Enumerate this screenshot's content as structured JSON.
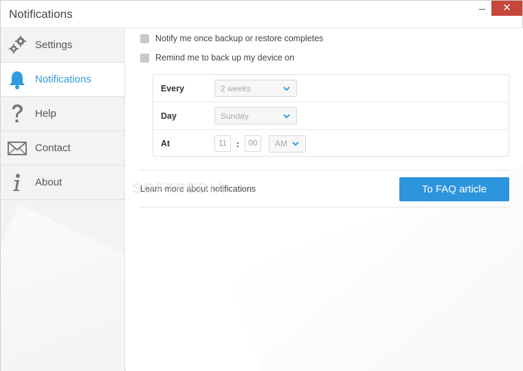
{
  "window": {
    "title": "Notifications",
    "minimize_glyph": "",
    "close_glyph": "✕"
  },
  "sidebar": {
    "items": [
      {
        "label": "Settings",
        "icon": "gears-icon"
      },
      {
        "label": "Notifications",
        "icon": "bell-icon",
        "active": true
      },
      {
        "label": "Help",
        "icon": "question-mark-icon"
      },
      {
        "label": "Contact",
        "icon": "envelope-icon"
      },
      {
        "label": "About",
        "icon": "info-icon"
      }
    ]
  },
  "main": {
    "notify_backup": {
      "label": "Notify me once backup or restore completes",
      "checked": false
    },
    "remind_backup": {
      "label": "Remind me to back up my device on",
      "checked": false
    },
    "schedule": {
      "every_label": "Every",
      "every_value": "2 weeks",
      "day_label": "Day",
      "day_value": "Sunday",
      "at_label": "At",
      "hour_value": "11",
      "time_separator": ":",
      "minute_value": "00",
      "ampm_value": "AM"
    },
    "faq": {
      "text": "Learn more about notifications",
      "button_label": "To FAQ article"
    }
  },
  "watermark": "SOFTPEDIA",
  "colors": {
    "accent": "#2d95dc",
    "active_text": "#2f9be0",
    "close_button": "#c7463a",
    "sidebar_bg": "#f3f3f3"
  }
}
